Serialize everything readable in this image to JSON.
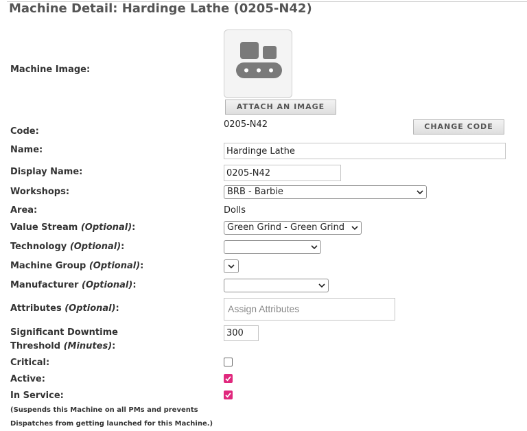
{
  "title": "Machine Detail: Hardinge Lathe (0205-N42)",
  "labels": {
    "machine_image": "Machine Image:",
    "code": "Code:",
    "name": "Name:",
    "display_name": "Display Name:",
    "workshops": "Workshops:",
    "area": "Area:",
    "value_stream": "Value Stream",
    "technology": "Technology",
    "machine_group": "Machine Group",
    "manufacturer": "Manufacturer",
    "attributes": "Attributes",
    "optional": "(Optional)",
    "significant_downtime_line1": "Significant Downtime",
    "significant_downtime_line2": "Threshold",
    "minutes": "(Minutes)",
    "critical": "Critical:",
    "active": "Active:",
    "in_service": "In Service:",
    "colon": ":"
  },
  "buttons": {
    "attach_image": "ATTACH AN IMAGE",
    "change_code": "CHANGE CODE"
  },
  "values": {
    "code": "0205-N42",
    "name": "Hardinge Lathe",
    "display_name": "0205-N42",
    "workshop": "BRB - Barbie",
    "area": "Dolls",
    "value_stream": "Green Grind - Green Grind",
    "technology": "",
    "machine_group": "",
    "manufacturer": "",
    "attributes_placeholder": "Assign Attributes",
    "downtime_threshold": "300"
  },
  "checkboxes": {
    "critical": false,
    "active": true,
    "in_service": true
  },
  "notes": {
    "in_service_line1": "(Suspends this Machine on all PMs and prevents",
    "in_service_line2": "Dispatches from getting launched for this Machine.)"
  },
  "colors": {
    "checkbox_checked": "#e0287d",
    "icon_gray": "#7a7a7a"
  },
  "icons": {
    "machine_placeholder": "machine-conveyor-icon",
    "dropdown": "chevron-down-icon",
    "checkmark": "checkmark-icon"
  }
}
